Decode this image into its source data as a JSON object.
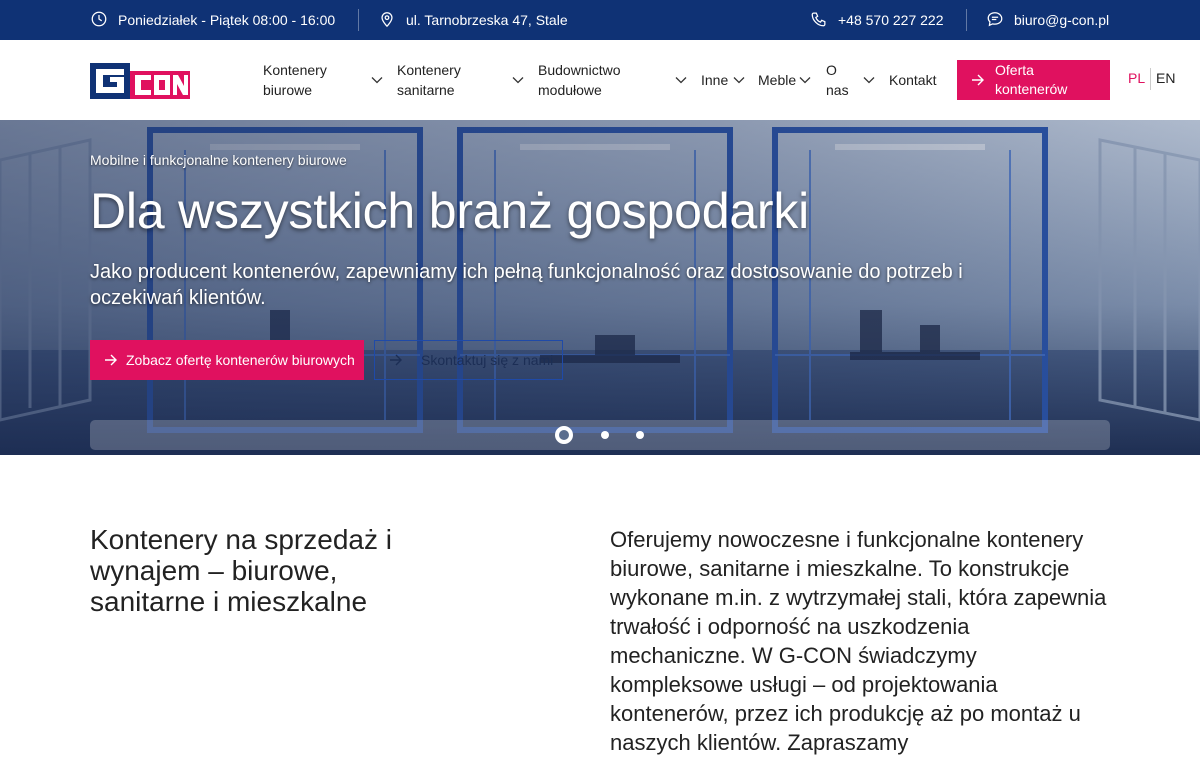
{
  "topbar": {
    "hours": "Poniedziałek - Piątek 08:00 - 16:00",
    "address": "ul. Tarnobrzeska 47, Stale",
    "phone": "+48 570 227 222",
    "email": "biuro@g-con.pl",
    "icons": [
      "clock-icon",
      "location-pin-icon",
      "phone-icon",
      "chat-icon"
    ]
  },
  "brand": {
    "logo_text": "GCON",
    "colors": {
      "navy": "#0f3275",
      "accent": "#e0115f"
    }
  },
  "nav": {
    "items": [
      {
        "line1": "Kontenery",
        "line2": "biurowe"
      },
      {
        "line1": "Kontenery",
        "line2": "sanitarne"
      },
      {
        "line1": "Budownictwo",
        "line2": "modułowe"
      },
      {
        "line1": "Inne",
        "line2": ""
      },
      {
        "line1": "Meble",
        "line2": ""
      },
      {
        "line1": "O",
        "line2": "nas"
      },
      {
        "line1": "Kontakt",
        "line2": ""
      }
    ],
    "cta": {
      "line1": "Oferta",
      "line2": "kontenerów"
    },
    "lang": {
      "pl": "PL",
      "en": "EN",
      "active": "PL"
    }
  },
  "hero": {
    "eyebrow": "Mobilne i funkcjonalne kontenery biurowe",
    "title": "Dla wszystkich branż gospodarki",
    "lead": "Jako producent kontenerów, zapewniamy ich pełną funkcjonalność oraz dostosowanie do potrzeb i oczekiwań klientów.",
    "primary_button": "Zobacz ofertę kontenerów biurowych",
    "secondary_button": "Skontaktuj się z nami",
    "slides": {
      "count": 3,
      "active": 1
    }
  },
  "intro": {
    "title": "Kontenery na sprzedaż i wynajem – biurowe, sanitarne i mieszkalne",
    "text": "Oferujemy nowoczesne i funkcjonalne kontenery biurowe, sanitarne i mieszkalne. To konstrukcje wykonane m.in. z wytrzymałej stali, która zapewnia trwałość i odporność na uszkodzenia mechaniczne. W G-CON świadczymy kompleksowe usługi – od projektowania kontenerów, przez ich produkcję aż po montaż u naszych klientów. Zapraszamy"
  }
}
